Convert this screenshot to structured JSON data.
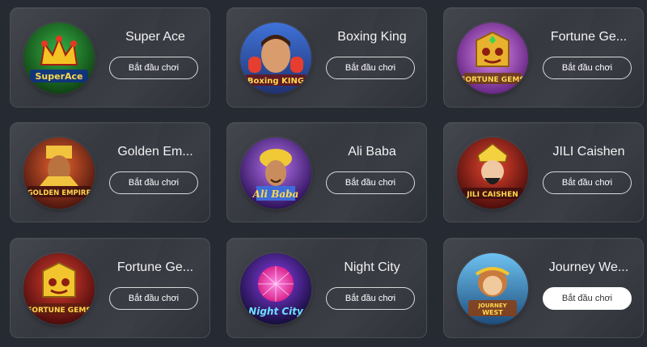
{
  "games": [
    {
      "title": "Super Ace",
      "button": "Bắt đầu chơi",
      "thumb_text": "SuperAce",
      "colors": [
        "#1f8a2a",
        "#0f4d14"
      ],
      "accent": "#f4c21f"
    },
    {
      "title": "Boxing King",
      "button": "Bắt đầu chơi",
      "thumb_text": "Boxing KING",
      "colors": [
        "#3a6fd8",
        "#1d2f6e"
      ],
      "accent": "#e63a2a"
    },
    {
      "title": "Fortune Ge...",
      "button": "Bắt đầu chơi",
      "thumb_text": "FORTUNE GEMS",
      "colors": [
        "#c86be0",
        "#6a2a8a"
      ],
      "accent": "#e8b02a"
    },
    {
      "title": "Golden Em...",
      "button": "Bắt đầu chơi",
      "thumb_text": "GOLDEN EMPIRE",
      "colors": [
        "#d8462a",
        "#5a1a0e"
      ],
      "accent": "#f2c23a"
    },
    {
      "title": "Ali Baba",
      "button": "Bắt đầu chơi",
      "thumb_text": "Ali Baba",
      "colors": [
        "#9a52d8",
        "#3a1a6a"
      ],
      "accent": "#f0c832"
    },
    {
      "title": "JILI Caishen",
      "button": "Bắt đầu chơi",
      "thumb_text": "JILI CAISHEN",
      "colors": [
        "#c4281e",
        "#5a0e0a"
      ],
      "accent": "#f4d03a"
    },
    {
      "title": "Fortune Ge...",
      "button": "Bắt đầu chơi",
      "thumb_text": "FORTUNE GEMS",
      "colors": [
        "#c42a1e",
        "#5a0a0a"
      ],
      "accent": "#f2c42a"
    },
    {
      "title": "Night City",
      "button": "Bắt đầu chơi",
      "thumb_text": "Night City",
      "colors": [
        "#6a2ad8",
        "#1a0a4a"
      ],
      "accent": "#ff4ad8"
    },
    {
      "title": "Journey We...",
      "button": "Bắt đầu chơi",
      "thumb_text": "JOURNEY WEST",
      "colors": [
        "#3a9ae0",
        "#1a4a7a"
      ],
      "accent": "#f29a2a"
    }
  ],
  "active_index": 8
}
